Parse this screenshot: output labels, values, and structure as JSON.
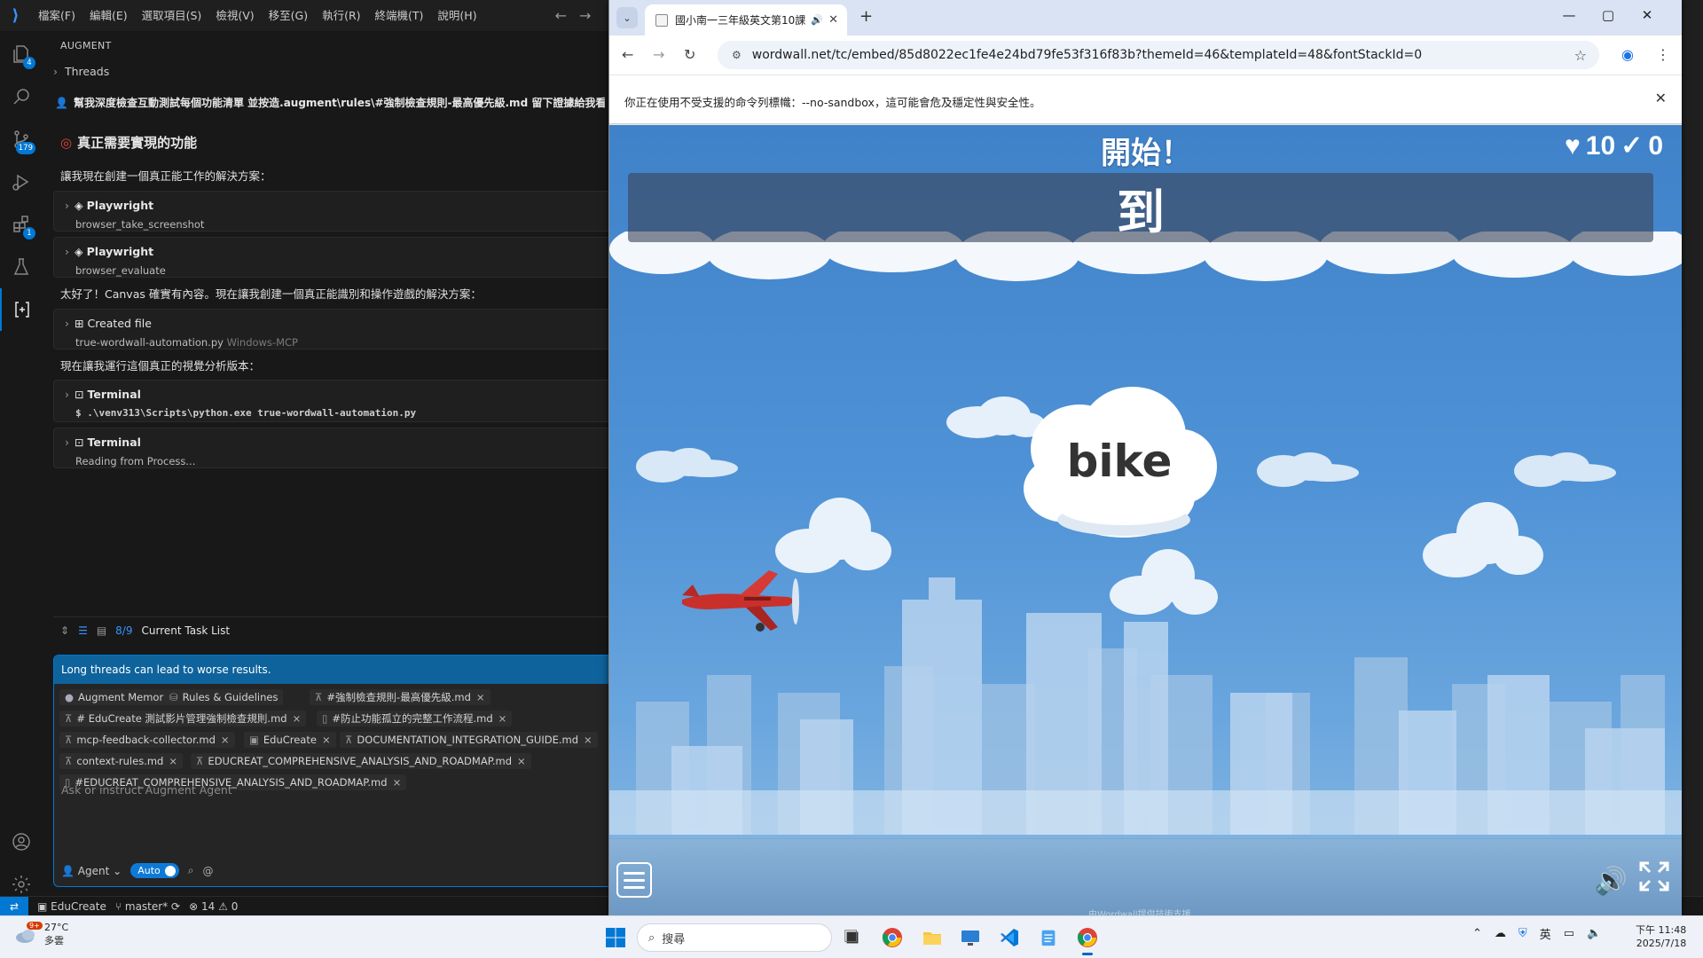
{
  "vscode": {
    "menu": [
      "檔案(F)",
      "編輯(E)",
      "選取項目(S)",
      "檢視(V)",
      "移至(G)",
      "執行(R)",
      "終端機(T)",
      "說明(H)"
    ],
    "activity_badges": {
      "explorer": "4",
      "source_control": "179",
      "extensions": "1"
    },
    "panel_title": "AUGMENT",
    "threads_label": "Threads",
    "chat_request": "幫我深度檢查互動測試每個功能清單 並按造.augment\\rules\\#強制檢查規則-最高優先級.md 留下證據給我看 ###",
    "section_heading": "真正需要實現的功能",
    "msg1": "讓我現在創建一個真正能工作的解決方案：",
    "tool_cards": [
      {
        "title": "Playwright",
        "sub": "browser_take_screenshot"
      },
      {
        "title": "Playwright",
        "sub": "browser_evaluate"
      }
    ],
    "msg2": "太好了！Canvas 確實有內容。現在讓我創建一個真正能識別和操作遊戲的解決方案：",
    "created_file": {
      "title": "Created file",
      "file": "true-wordwall-automation.py",
      "tool": "Windows-MCP"
    },
    "msg3": "現在讓我運行這個真正的視覺分析版本：",
    "terminal1": {
      "title": "Terminal",
      "command": "$ .\\venv313\\Scripts\\python.exe true-wordwall-automation.py"
    },
    "terminal2": {
      "title": "Terminal",
      "status": "Reading from Process..."
    },
    "task_list": {
      "count": "8/9",
      "label": "Current Task List"
    },
    "warning": "Long threads can lead to worse results.",
    "chips": [
      "Augment Memories",
      "Rules & Guidelines",
      "#強制檢查規則-最高優先級.md",
      "# EduCreate 測試影片管理強制檢查規則.md",
      "#防止功能孤立的完整工作流程.md",
      "mcp-feedback-collector.md",
      "EduCreate",
      "DOCUMENTATION_INTEGRATION_GUIDE.md",
      "context-rules.md",
      "EDUCREAT_COMPREHENSIVE_ANALYSIS_AND_ROADMAP.md",
      "#EDUCREAT_COMPREHENSIVE_ANALYSIS_AND_ROADMAP.md"
    ],
    "prompt_placeholder": "Ask or instruct Augment Agent",
    "agent_label": "Agent",
    "auto_label": "Auto",
    "status": {
      "project": "EduCreate",
      "branch": "master*",
      "problems": "14",
      "warnings": "0"
    }
  },
  "chrome": {
    "tab_title": "國小南一三年級英文第10課",
    "url": "wordwall.net/tc/embed/85d8022ec1fe4e24bd79fe53f316f83b?themeId=46&templateId=48&fontStackId=0",
    "infobar": "你正在使用不受支援的命令列標幟：--no-sandbox，這可能會危及穩定性與安全性。"
  },
  "game": {
    "status_text": "開始！",
    "lives": "10",
    "score": "0",
    "question": "到",
    "answer": "bike",
    "credit": "由Wordwall提供技術支援"
  },
  "taskbar": {
    "weather_temp": "27°C",
    "weather_desc": "多雲",
    "weather_badge": "9+",
    "search_placeholder": "搜尋",
    "ime": "英",
    "time": "下午 11:48",
    "date": "2025/7/18"
  },
  "colors": {
    "vscode_accent": "#0078d4",
    "game_sky": "#4f92d6",
    "plane": "#c9302c"
  }
}
